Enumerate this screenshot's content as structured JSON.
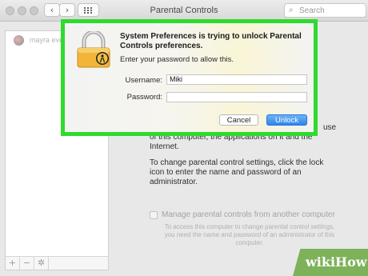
{
  "window": {
    "title": "Parental Controls"
  },
  "toolbar": {
    "back_icon": "chevron-left-icon",
    "forward_icon": "chevron-right-icon",
    "show_all_icon": "grid-icon",
    "search_placeholder": "Search"
  },
  "sidebar": {
    "users": [
      {
        "name": "mayra eve"
      }
    ],
    "footer_buttons": [
      {
        "label": "+"
      },
      {
        "label": "−"
      },
      {
        "icon": "gear-icon"
      }
    ]
  },
  "main": {
    "partial_line_1": "use",
    "partial_line_2": "of this computer, the applications on it and the",
    "partial_line_3": "Internet.",
    "lock_instructions": "To change parental control settings, click the lock icon to enter the name and password of an administrator.",
    "lock_instructions_lines": [
      "To change parental control settings, click the lock",
      "icon to enter the name and password of an",
      "administrator."
    ],
    "manage_checkbox": {
      "label": "Manage parental controls from another computer",
      "checked": false
    },
    "manage_description": "To access this computer to change parental control settings, you need the name and password of an administrator of this computer."
  },
  "dialog": {
    "title": "System Preferences is trying to unlock Parental Controls preferences.",
    "subtitle": "Enter your password to allow this.",
    "username_label": "Username:",
    "username_value": "Miki",
    "password_label": "Password:",
    "password_value": "",
    "cancel_label": "Cancel",
    "unlock_label": "Unlock",
    "highlight_color": "#2edb2e",
    "accent_color": "#2f86ee"
  },
  "watermark": {
    "text": "wikiHow"
  }
}
